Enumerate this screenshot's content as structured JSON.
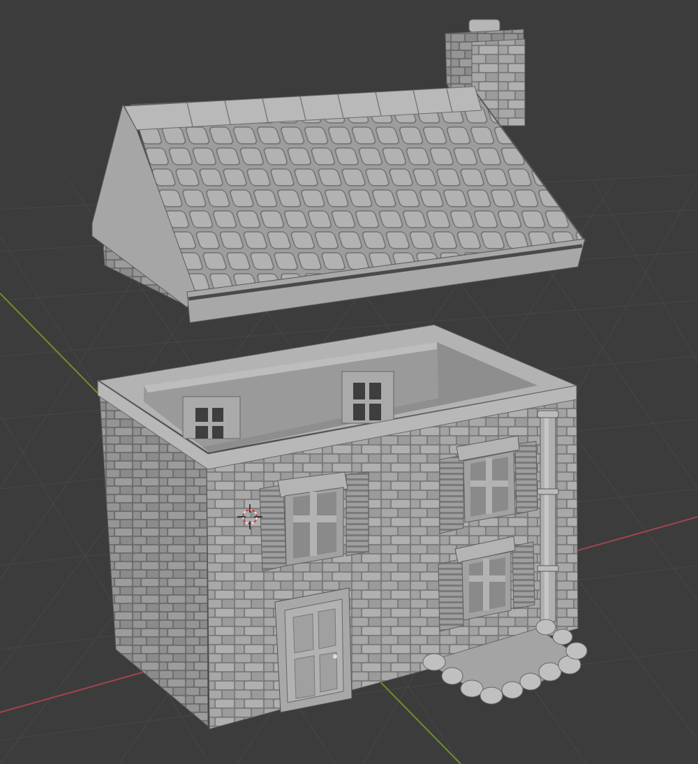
{
  "viewport": {
    "mode": "3d-viewport",
    "background_color": "#3c3c3c",
    "grid_color": "#4a4a4a",
    "x_axis_color": "#b8464f",
    "y_axis_color": "#7a9a2e",
    "model_color": "#a9a9a9"
  },
  "objects": [
    {
      "name": "roof",
      "icon": "gable-roof-with-chimney"
    },
    {
      "name": "house-body",
      "icon": "stone-house-walls"
    }
  ],
  "cursor": {
    "icon": "3d-cursor-icon"
  }
}
